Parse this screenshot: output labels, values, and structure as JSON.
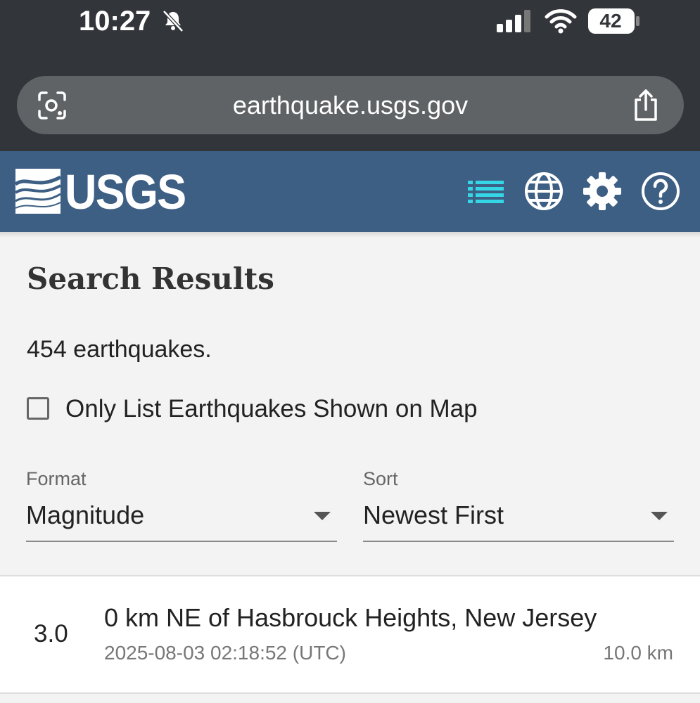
{
  "status_bar": {
    "time": "10:27",
    "battery": "42",
    "icons": [
      "bell-slash-icon",
      "cellular-signal-icon",
      "wifi-icon",
      "battery-icon"
    ]
  },
  "browser": {
    "url": "earthquake.usgs.gov",
    "icons": [
      "visual-lookup-icon",
      "share-icon"
    ]
  },
  "header": {
    "logo": "USGS",
    "icons": [
      "list-icon",
      "globe-icon",
      "settings-gear-icon",
      "help-icon"
    ],
    "colors": {
      "background": "#3d5f84",
      "active_icon": "#35d7e6"
    }
  },
  "search": {
    "title": "Search Results",
    "count": "454 earthquakes.",
    "checkbox_label": "Only List Earthquakes Shown on Map",
    "checkbox_checked": false,
    "format_label": "Format",
    "format_value": "Magnitude",
    "sort_label": "Sort",
    "sort_value": "Newest First"
  },
  "results": [
    {
      "magnitude": "3.0",
      "place": "0 km NE of Hasbrouck Heights, New Jersey",
      "time": "2025-08-03 02:18:52 (UTC)",
      "depth": "10.0 km"
    }
  ]
}
